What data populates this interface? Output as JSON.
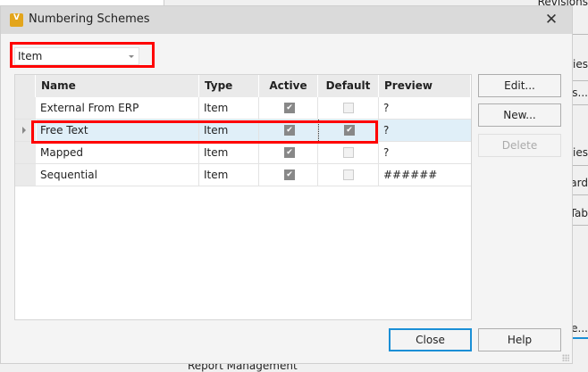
{
  "background": {
    "labels": [
      "Revisions",
      "ries",
      "s...",
      "ties",
      "ard",
      "Tab",
      "ne...",
      "Report Management"
    ]
  },
  "dialog": {
    "title": "Numbering Schemes",
    "logo": "V",
    "close_icon": "close-icon"
  },
  "filter": {
    "value": "Item"
  },
  "grid": {
    "columns": [
      "Name",
      "Type",
      "Active",
      "Default",
      "Preview"
    ],
    "rows": [
      {
        "name": "External From ERP",
        "type": "Item",
        "active": true,
        "default": false,
        "preview": "?"
      },
      {
        "name": "Free Text",
        "type": "Item",
        "active": true,
        "default": true,
        "preview": "?",
        "selected": true
      },
      {
        "name": "Mapped",
        "type": "Item",
        "active": true,
        "default": false,
        "preview": "?"
      },
      {
        "name": "Sequential",
        "type": "Item",
        "active": true,
        "default": false,
        "preview": "######"
      }
    ]
  },
  "buttons": {
    "edit": "Edit...",
    "new": "New...",
    "delete": "Delete",
    "close": "Close",
    "help": "Help"
  },
  "colors": {
    "highlight": "#ff0000",
    "accent": "#1a8fd6",
    "selected_row": "#e0eff8"
  }
}
